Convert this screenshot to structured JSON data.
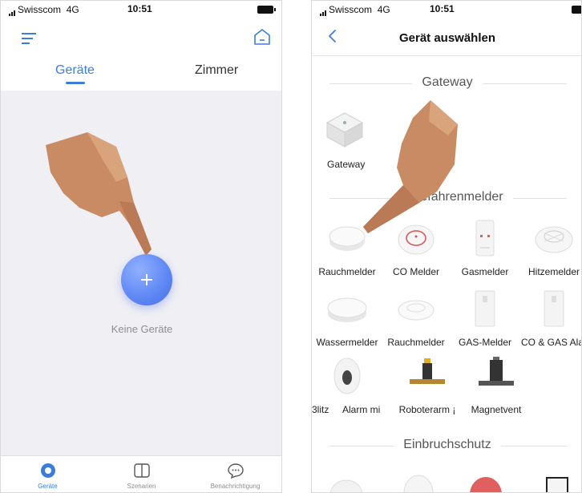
{
  "left_screen": {
    "status": {
      "carrier": "Swisscom",
      "network": "4G",
      "time": "10:51"
    },
    "tabs": [
      {
        "label": "Geräte"
      },
      {
        "label": "Zimmer"
      }
    ],
    "empty_state": {
      "text": "Keine Geräte"
    },
    "bottom_tabs": [
      {
        "label": "Geräte",
        "icon": "circle-icon"
      },
      {
        "label": "Szenarien",
        "icon": "book-icon"
      },
      {
        "label": "Benachrichtigung",
        "icon": "chat-bubble-icon"
      }
    ],
    "colors": {
      "accent": "#3b7ddd",
      "button": "#5e86f4",
      "background": "#efeff4"
    }
  },
  "right_screen": {
    "status": {
      "carrier": "Swisscom",
      "network": "4G",
      "time": "10:51"
    },
    "title": "Gerät auswählen",
    "sections": [
      {
        "title": "Gateway",
        "items": [
          {
            "label": "Gateway"
          }
        ]
      },
      {
        "title": "Gefahrenmelder",
        "visible_title": "efahrenmelder",
        "items": [
          {
            "label": "Rauchmelder"
          },
          {
            "label": "CO Melder"
          },
          {
            "label": "Gasmelder"
          },
          {
            "label": "Hitzemelder"
          },
          {
            "label": "Wassermelder"
          },
          {
            "label": "Rauchmelder"
          },
          {
            "label": "GAS-Melder"
          },
          {
            "label": "CO & GAS Alarm",
            "visible_label": "CO & GAS Alar"
          },
          {
            "label": "Blitz",
            "visible_label": "3litz"
          },
          {
            "label": "Alarm mi"
          },
          {
            "label": "Roboterarm",
            "visible_label": "Roboterarm   ¡"
          },
          {
            "label": "Magnetvent"
          }
        ]
      },
      {
        "title": "Einbruchschutz",
        "items": []
      }
    ]
  }
}
